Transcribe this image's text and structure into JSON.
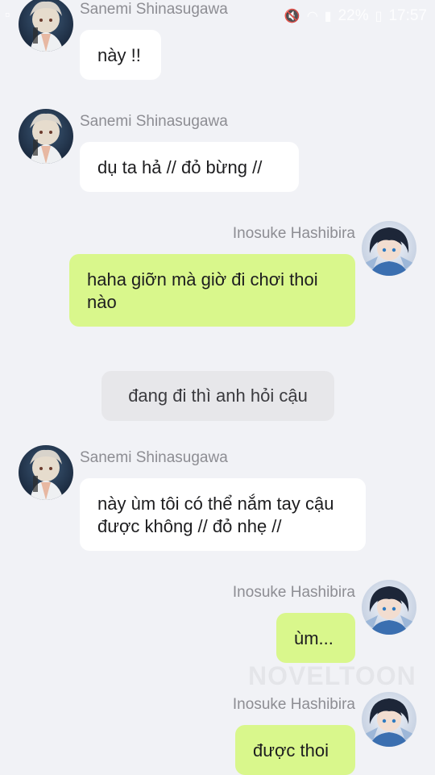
{
  "status_bar": {
    "battery": "22%",
    "time": "17:57"
  },
  "messages": [
    {
      "sender": "Sanemi Shinasugawa",
      "text": "này !!",
      "side": "left"
    },
    {
      "sender": "Sanemi Shinasugawa",
      "text": "dụ ta hả // đỏ bừng //",
      "side": "left"
    },
    {
      "sender": "Inosuke Hashibira",
      "text": "haha giỡn mà giờ đi chơi thoi nào",
      "side": "right"
    },
    {
      "narration": "đang đi thì anh hỏi cậu"
    },
    {
      "sender": "Sanemi Shinasugawa",
      "text": "này ùm tôi có thể nắm tay cậu được không // đỏ nhẹ //",
      "side": "left"
    },
    {
      "sender": "Inosuke Hashibira",
      "text": "ùm...",
      "side": "right"
    },
    {
      "sender": "Inosuke Hashibira",
      "text": "được thoi",
      "side": "right"
    }
  ],
  "watermark": "NOVELTOON",
  "colors": {
    "background": "#f1f2f6",
    "left_bubble": "#ffffff",
    "right_bubble": "#d9f78c",
    "narration_bubble": "#e7e7ea",
    "name": "#8d8d93"
  },
  "icons": [
    "sanemi-avatar",
    "inosuke-avatar",
    "signal-icon",
    "wifi-icon",
    "battery-icon"
  ]
}
